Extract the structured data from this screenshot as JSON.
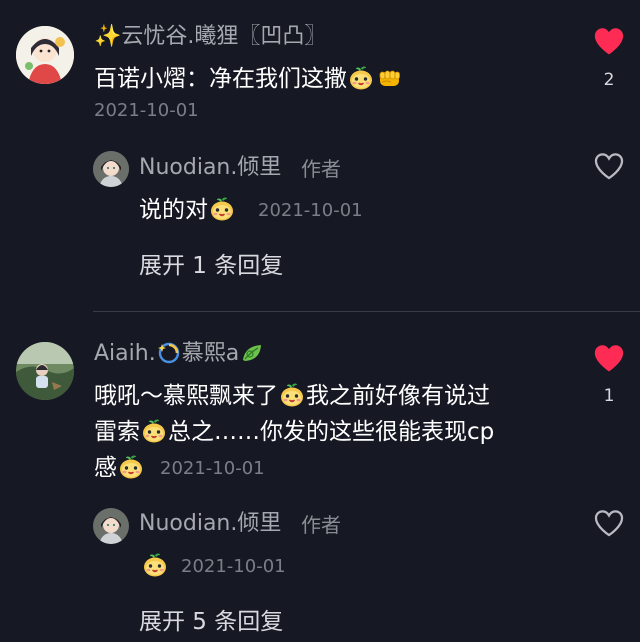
{
  "colors": {
    "background": "#161823",
    "like_red": "#fe2c55",
    "secondary_text": "#a6a8b0"
  },
  "comments": [
    {
      "username": "✨云忧谷.曦狸〖凹凸〗",
      "text_part1": "百诺小熠：净在我们这撒",
      "date": "2021-10-01",
      "likes": "2",
      "liked": true,
      "emojis": [
        "bun-face-emoji",
        "fist-emoji"
      ],
      "reply": {
        "username": "Nuodian.倾里",
        "author_tag": "作者",
        "text": "说的对",
        "emojis": [
          "bun-face-emoji"
        ],
        "date": "2021-10-01",
        "liked": false
      },
      "expand_label": "展开 1 条回复"
    },
    {
      "username_part1": "Aiaih.",
      "username_part2": "慕熙a",
      "line1_a": "哦吼～慕熙飘来了",
      "line1_b": "我之前好像有说过",
      "line2_a": "雷索",
      "line2_b": "总之……你发的这些很能表现cp",
      "line3": "感",
      "date": "2021-10-01",
      "likes": "1",
      "liked": true,
      "reply": {
        "username": "Nuodian.倾里",
        "author_tag": "作者",
        "emojis": [
          "bun-face-emoji"
        ],
        "date": "2021-10-01",
        "liked": false
      },
      "expand_label": "展开 5 条回复"
    }
  ]
}
